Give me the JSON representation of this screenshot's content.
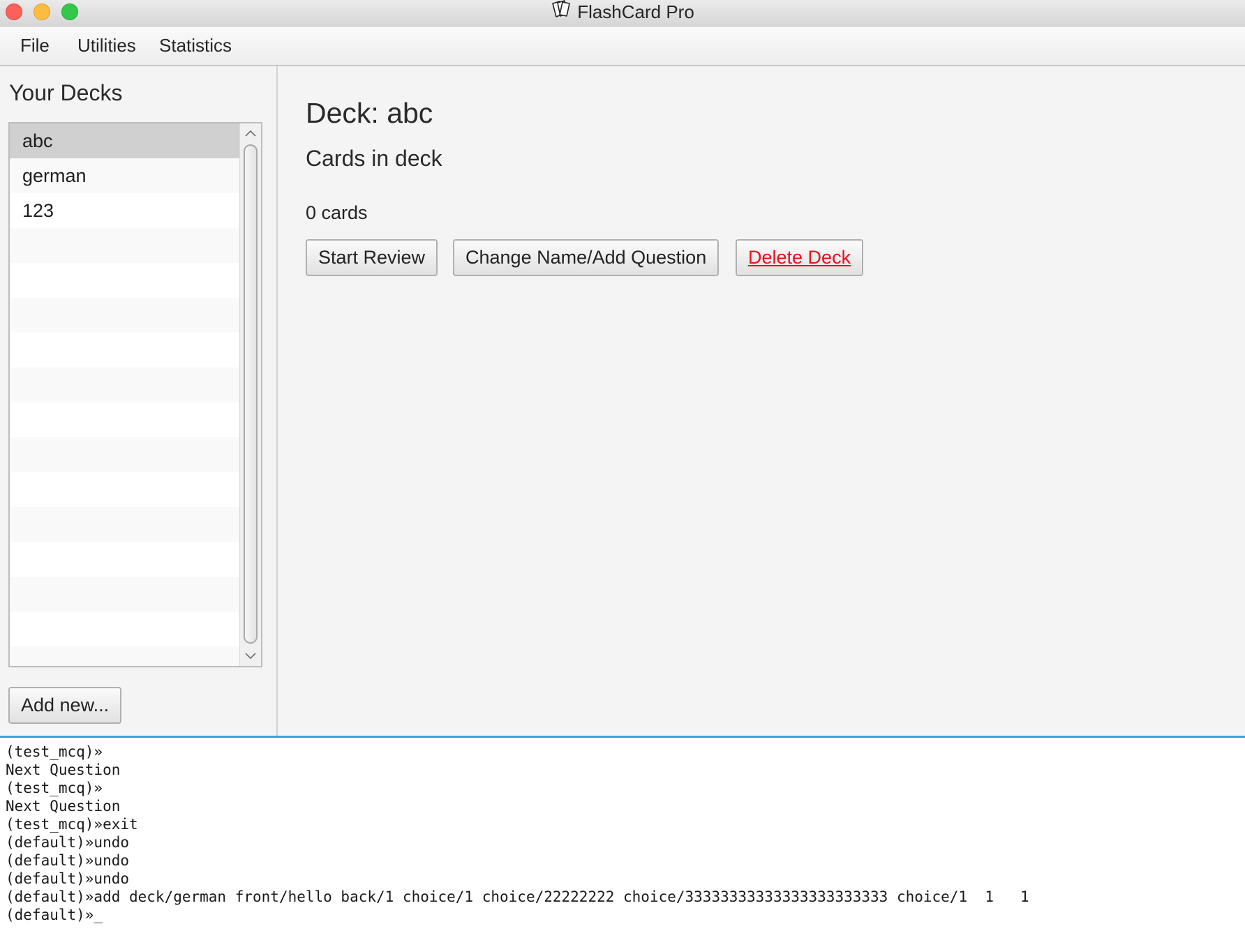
{
  "window": {
    "title": "FlashCard Pro"
  },
  "menu": {
    "items": [
      "File",
      "Utilities",
      "Statistics"
    ]
  },
  "sidebar": {
    "heading": "Your Decks",
    "decks": [
      "abc",
      "german",
      "123"
    ],
    "selected_deck": "abc",
    "add_button": "Add new..."
  },
  "main": {
    "deck_title": "Deck: abc",
    "cards_heading": "Cards in deck",
    "card_count": "0 cards",
    "buttons": {
      "start_review": "Start Review",
      "change_name": "Change Name/Add Question",
      "delete_deck": "Delete Deck"
    },
    "delete_color": "#e8101a"
  },
  "console": {
    "lines": [
      "(test_mcq)»",
      "Next Question",
      "(test_mcq)»",
      "Next Question",
      "(test_mcq)»exit",
      "(default)»undo",
      "(default)»undo",
      "(default)»undo",
      "(default)»add deck/german front/hello back/1 choice/1 choice/22222222 choice/33333333333333333333333 choice/1  1   1",
      "(default)»_"
    ]
  },
  "colors": {
    "accent_divider": "#3aa6dc",
    "close": "#fc605b",
    "minimize": "#fdbc40",
    "maximize": "#34c84a"
  },
  "icons": {
    "app": "flashcards-icon"
  }
}
